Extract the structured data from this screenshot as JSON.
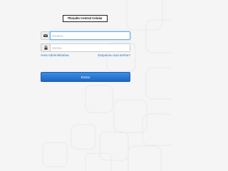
{
  "header": {
    "logo_text": "Planalto Central Celular"
  },
  "login": {
    "username": {
      "placeholder": "Usuário",
      "value": "",
      "icon": "envelope-icon"
    },
    "password": {
      "placeholder": "Senha",
      "value": "",
      "icon": "lock-icon"
    },
    "admin_link": "Área Administrativa",
    "forgot_link": "Esqueceu sua senha?",
    "submit_label": "Entrar"
  },
  "colors": {
    "background": "#f5f5f5",
    "accent": "#1f66c2",
    "link": "#2a6ebb",
    "focus_border": "#66afe9"
  }
}
